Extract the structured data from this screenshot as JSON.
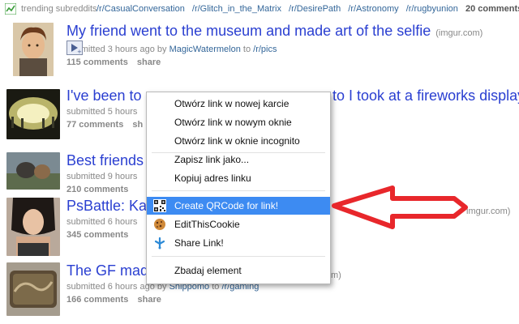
{
  "trending": {
    "label": "trending subreddits",
    "links": [
      "/r/CasualConversation",
      "/r/Glitch_in_the_Matrix",
      "/r/DesirePath",
      "/r/Astronomy",
      "/r/rugbyunion"
    ],
    "count": "20 comments"
  },
  "posts": [
    {
      "title": "My friend went to the museum and made art of the selfie",
      "domain": "(imgur.com)",
      "submitted": "submitted 3 hours ago by",
      "user": "MagicWatermelon",
      "to": "to",
      "subreddit": "/r/pics",
      "comments": "115 comments",
      "share": "share"
    },
    {
      "title": "I've been to",
      "title_tail": "to I took at a fireworks display",
      "submitted": "submitted 5 hours",
      "comments": "77 comments",
      "share_partial": "sh"
    },
    {
      "title": "Best friends",
      "submitted": "submitted 9 hours",
      "comments": "210 comments"
    },
    {
      "title": "PsBattle: Ka",
      "domain": "imgur.com)",
      "submitted": "submitted 6 hours",
      "comments": "345 comments"
    },
    {
      "title": "The GF mad",
      "domain_partial": "m)",
      "submitted": "submitted 6 hours ago by",
      "user": "Shippomo",
      "to": "to",
      "subreddit": "/r/gaming",
      "comments": "166 comments",
      "share": "share"
    }
  ],
  "context_menu": {
    "items": [
      "Otwórz link w nowej karcie",
      "Otwórz link w nowym oknie",
      "Otwórz link w oknie incognito",
      "Zapisz link jako...",
      "Kopiuj adres linku",
      "Create QRCode for link!",
      "EditThisCookie",
      "Share Link!",
      "Zbadaj element"
    ],
    "highlighted_index": 5,
    "highlight_color": "#3d8bf2"
  },
  "annotation": {
    "arrow_color": "#e8272b"
  },
  "colors": {
    "link": "#2a3fd1",
    "meta_link": "#336699",
    "meta": "#888888"
  }
}
